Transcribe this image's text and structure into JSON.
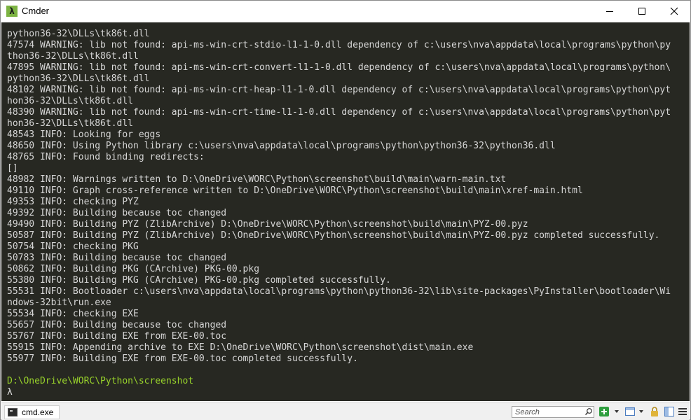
{
  "window": {
    "title": "Cmder",
    "app_icon_glyph": "λ",
    "controls": [
      "minimize-icon",
      "maximize-icon",
      "close-icon"
    ]
  },
  "console": {
    "colors": {
      "background": "#272822",
      "text": "#d6d6d6",
      "path": "#98d22b"
    },
    "lines": [
      "python36-32\\DLLs\\tk86t.dll",
      "47574 WARNING: lib not found: api-ms-win-crt-stdio-l1-1-0.dll dependency of c:\\users\\nva\\appdata\\local\\programs\\python\\py",
      "thon36-32\\DLLs\\tk86t.dll",
      "47895 WARNING: lib not found: api-ms-win-crt-convert-l1-1-0.dll dependency of c:\\users\\nva\\appdata\\local\\programs\\python\\",
      "python36-32\\DLLs\\tk86t.dll",
      "48102 WARNING: lib not found: api-ms-win-crt-heap-l1-1-0.dll dependency of c:\\users\\nva\\appdata\\local\\programs\\python\\pyt",
      "hon36-32\\DLLs\\tk86t.dll",
      "48390 WARNING: lib not found: api-ms-win-crt-time-l1-1-0.dll dependency of c:\\users\\nva\\appdata\\local\\programs\\python\\pyt",
      "hon36-32\\DLLs\\tk86t.dll",
      "48543 INFO: Looking for eggs",
      "48650 INFO: Using Python library c:\\users\\nva\\appdata\\local\\programs\\python\\python36-32\\python36.dll",
      "48765 INFO: Found binding redirects:",
      "[]",
      "48982 INFO: Warnings written to D:\\OneDrive\\WORC\\Python\\screenshot\\build\\main\\warn-main.txt",
      "49110 INFO: Graph cross-reference written to D:\\OneDrive\\WORC\\Python\\screenshot\\build\\main\\xref-main.html",
      "49353 INFO: checking PYZ",
      "49392 INFO: Building because toc changed",
      "49490 INFO: Building PYZ (ZlibArchive) D:\\OneDrive\\WORC\\Python\\screenshot\\build\\main\\PYZ-00.pyz",
      "50587 INFO: Building PYZ (ZlibArchive) D:\\OneDrive\\WORC\\Python\\screenshot\\build\\main\\PYZ-00.pyz completed successfully.",
      "50754 INFO: checking PKG",
      "50783 INFO: Building because toc changed",
      "50862 INFO: Building PKG (CArchive) PKG-00.pkg",
      "55380 INFO: Building PKG (CArchive) PKG-00.pkg completed successfully.",
      "55531 INFO: Bootloader c:\\users\\nva\\appdata\\local\\programs\\python\\python36-32\\lib\\site-packages\\PyInstaller\\bootloader\\Wi",
      "ndows-32bit\\run.exe",
      "55534 INFO: checking EXE",
      "55657 INFO: Building because toc changed",
      "55767 INFO: Building EXE from EXE-00.toc",
      "55915 INFO: Appending archive to EXE D:\\OneDrive\\WORC\\Python\\screenshot\\dist\\main.exe",
      "55977 INFO: Building EXE from EXE-00.toc completed successfully."
    ],
    "cwd": "D:\\OneDrive\\WORC\\Python\\screenshot",
    "prompt": "λ"
  },
  "statusbar": {
    "tab_label": "cmd.exe",
    "search_placeholder": "Search",
    "icons": [
      "new-console-icon",
      "view-icon",
      "lock-icon",
      "split-view-icon",
      "menu-icon"
    ]
  }
}
